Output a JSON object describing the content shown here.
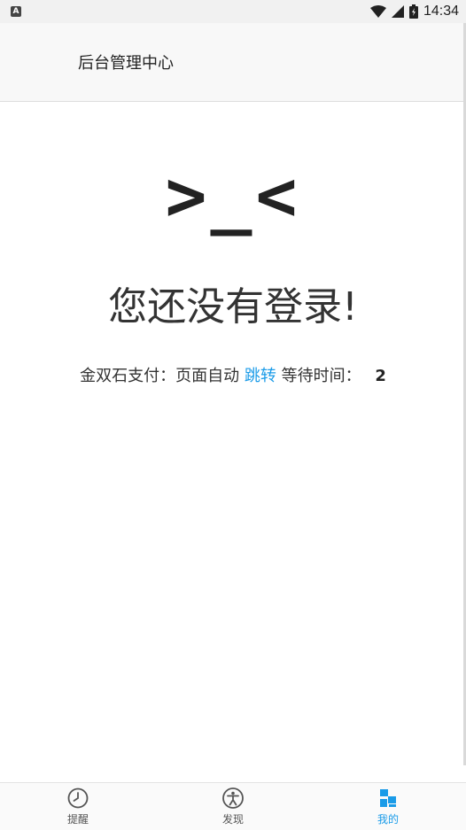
{
  "status_bar": {
    "app_icon_letter": "A",
    "time": "14:34"
  },
  "header": {
    "title": "后台管理中心"
  },
  "main": {
    "emoticon": ">_<",
    "message": "您还没有登录!",
    "redirect": {
      "prefix": "金双石支付：页面自动",
      "link_label": "跳转",
      "suffix": "等待时间：",
      "countdown": "2"
    }
  },
  "bottom_nav": {
    "items": [
      {
        "label": "提醒",
        "icon": "clock-icon"
      },
      {
        "label": "发现",
        "icon": "accessibility-icon"
      },
      {
        "label": "我的",
        "icon": "blocks-icon"
      }
    ],
    "active_index": 2
  },
  "colors": {
    "accent": "#1a9be8",
    "header_bg": "#f8f8f8",
    "statusbar_bg": "#f1f1f1"
  }
}
